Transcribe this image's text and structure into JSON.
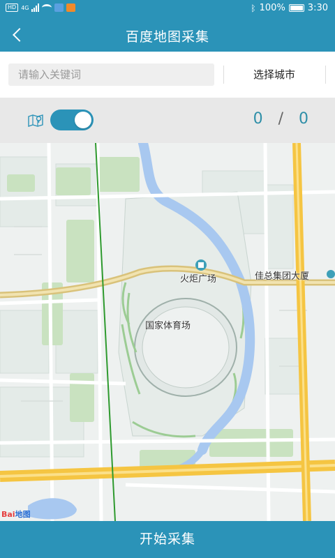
{
  "status_bar": {
    "network": "4G",
    "battery": "100%",
    "time": "3:30",
    "bluetooth_icon": "bluetooth-icon"
  },
  "header": {
    "title": "百度地图采集",
    "back_icon": "back-chevron-icon"
  },
  "search": {
    "placeholder": "请输入关键词",
    "value": "",
    "city_button": "选择城市"
  },
  "toolbar": {
    "toggle_on": true,
    "count_current": "0",
    "count_separator": "/",
    "count_total": "0"
  },
  "map": {
    "labels": {
      "torch_plaza": "火炬广场",
      "building": "佳总集团大厦",
      "stadium": "国家体育场"
    },
    "logo": "Bai",
    "logo_suffix": "地图"
  },
  "footer": {
    "start_button": "开始采集"
  },
  "colors": {
    "primary": "#2b93b8",
    "river": "#a8c8f0",
    "road_major": "#f5c542",
    "green_line": "#2e9a2e"
  }
}
